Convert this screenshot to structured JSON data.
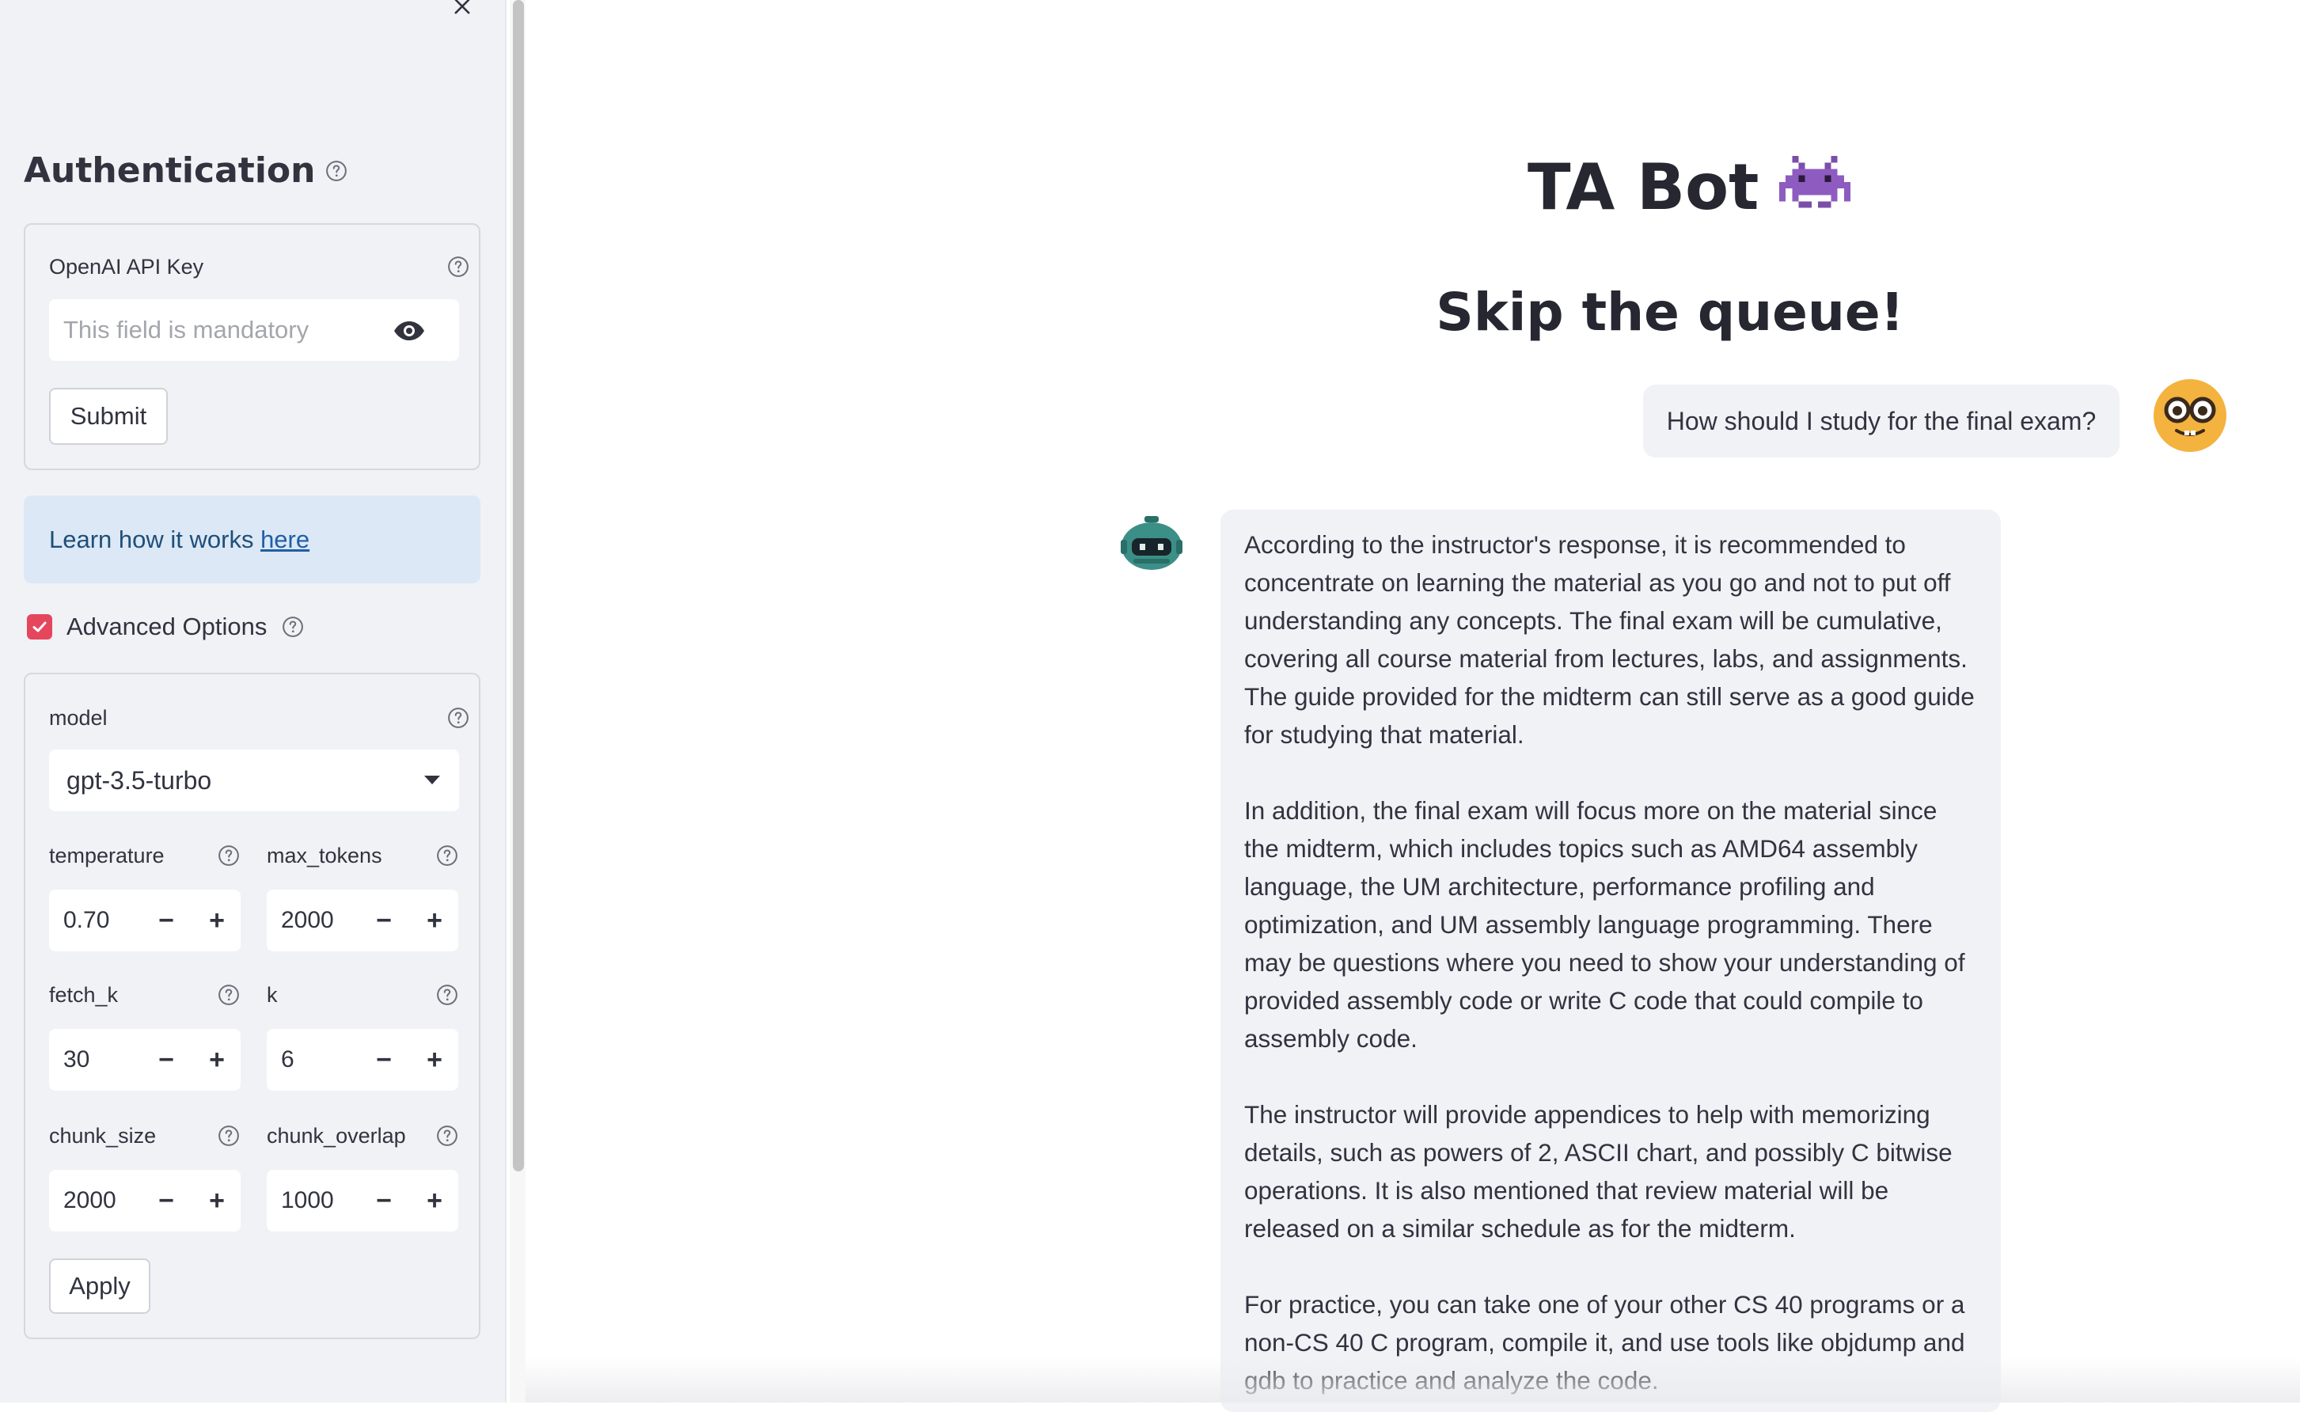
{
  "sidebar": {
    "auth_title": "Authentication",
    "api_key_label": "OpenAI API Key",
    "api_key_placeholder": "This field is mandatory",
    "submit_label": "Submit",
    "info_text": "Learn how it works ",
    "info_link": "here",
    "advanced_label": "Advanced Options",
    "advanced_checked": true,
    "model_label": "model",
    "model_value": "gpt-3.5-turbo",
    "params": [
      {
        "label": "temperature",
        "value": "0.70"
      },
      {
        "label": "max_tokens",
        "value": "2000"
      },
      {
        "label": "fetch_k",
        "value": "30"
      },
      {
        "label": "k",
        "value": "6"
      },
      {
        "label": "chunk_size",
        "value": "2000"
      },
      {
        "label": "chunk_overlap",
        "value": "1000"
      }
    ],
    "minus_symbol": "−",
    "plus_symbol": "+",
    "apply_label": "Apply"
  },
  "main": {
    "title": "TA Bot",
    "subtitle": "Skip the queue!",
    "user_message": "How should I study for the final exam?",
    "bot_paragraphs": [
      "According to the instructor's response, it is recommended to concentrate on learning the material as you go and not to put off understanding any concepts. The final exam will be cumulative, covering all course material from lectures, labs, and assignments. The guide provided for the midterm can still serve as a good guide for studying that material.",
      "In addition, the final exam will focus more on the material since the midterm, which includes topics such as AMD64 assembly language, the UM architecture, performance profiling and optimization, and UM assembly language programming. There may be questions where you need to show your understanding of provided assembly code or write C code that could compile to assembly code.",
      "The instructor will provide appendices to help with memorizing details, such as powers of 2, ASCII chart, and possibly C bitwise operations. It is also mentioned that review material will be released on a similar schedule as for the midterm.",
      "For practice, you can take one of your other CS 40 programs or a non-CS 40 C program, compile it, and use tools like objdump and gdb to practice and analyze the code."
    ]
  },
  "colors": {
    "sidebar_bg": "#f0f2f6",
    "accent_checkbox": "#e6455e",
    "info_bg": "#dce8f5",
    "link": "#1f5ea8"
  },
  "icons": [
    "close-icon",
    "help-icon",
    "eye-icon",
    "checkmark-icon",
    "chevron-down-icon",
    "monster-icon",
    "nerd-face-avatar-icon",
    "robot-avatar-icon"
  ]
}
